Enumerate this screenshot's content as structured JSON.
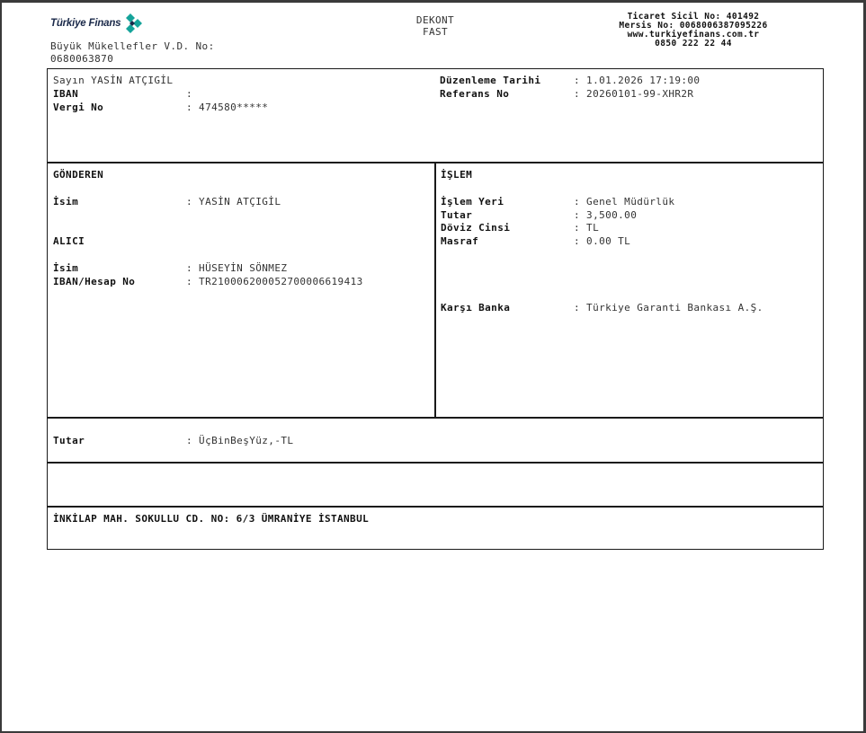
{
  "header": {
    "brand": "Türkiye Finans",
    "tax_office_label": "Büyük Mükellefler V.D. No:",
    "tax_office_no": "0680063870",
    "doc_title": "DEKONT",
    "doc_subtitle": "FAST",
    "trade_registry": "Ticaret Sicil No: 401492",
    "mersis": "Mersis No: 0068006387095226",
    "website": "www.turkiyefinans.com.tr",
    "phone": "0850 222 22 44"
  },
  "customer": {
    "greeting": "Sayın YASİN ATÇIGİL",
    "iban_label": "IBAN",
    "iban_value": ":",
    "tax_label": "Vergi No",
    "tax_value": ": 474580*****",
    "date_label": "Düzenleme Tarihi",
    "date_value": ": 1.01.2026 17:19:00",
    "ref_label": "Referans No",
    "ref_value": ": 20260101-99-XHR2R"
  },
  "sender": {
    "section_title": "GÖNDEREN",
    "name_label": "İsim",
    "name_value": ": YASİN ATÇIGİL"
  },
  "receiver": {
    "section_title": "ALICI",
    "name_label": "İsim",
    "name_value": ": HÜSEYİN SÖNMEZ",
    "iban_label": "IBAN/Hesap No",
    "iban_value": ": TR210006200052700006619413"
  },
  "transaction": {
    "section_title": "İŞLEM",
    "place_label": "İşlem Yeri",
    "place_value": ": Genel Müdürlük",
    "amount_label": "Tutar",
    "amount_value": ": 3,500.00",
    "currency_label": "Döviz Cinsi",
    "currency_value": ": TL",
    "fee_label": "Masraf",
    "fee_value": ": 0.00 TL",
    "bank_label": "Karşı Banka",
    "bank_value": ": Türkiye Garanti Bankası A.Ş."
  },
  "amount_words": {
    "label": "Tutar",
    "value": ": ÜçBinBeşYüz,-TL"
  },
  "footer": {
    "address": "İNKİLAP MAH. SOKULLU CD. NO: 6/3 ÜMRANİYE İSTANBUL"
  },
  "colors": {
    "brand_navy": "#1b2a4a",
    "brand_teal": "#15a39a"
  }
}
